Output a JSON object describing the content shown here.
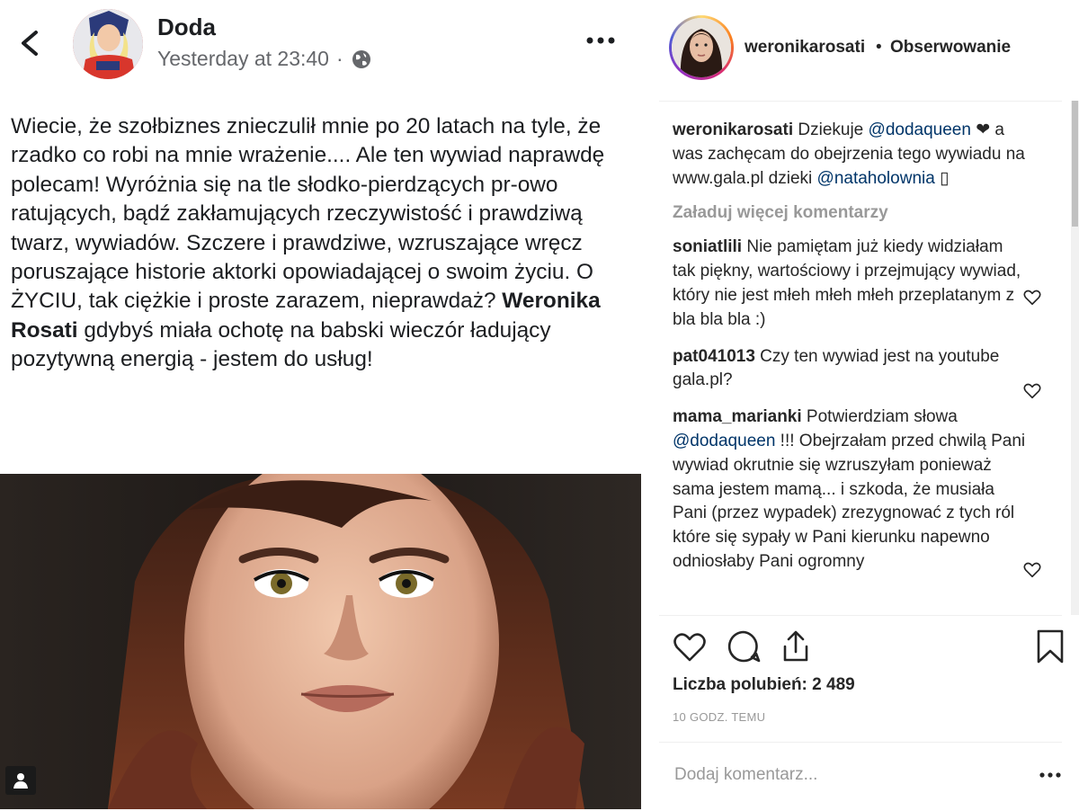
{
  "fb_post": {
    "author": "Doda",
    "timestamp": "Yesterday at 23:40",
    "separator": "·",
    "text_before": "Wiecie, że szołbiznes znieczulił mnie po 20 latach na tyle, że rzadko co robi na mnie wrażenie.... Ale ten wywiad naprawdę polecam! Wyróżnia się na tle słodko-pierdzących pr-owo ratujących, bądź zakłamujących rzeczywistość i prawdziwą twarz, wywiadów. Szczere i prawdziwe, wzruszające wręcz poruszające historie aktorki opowiadającej o swoim życiu. O ŻYCIU, tak ciężkie i proste zarazem, nieprawdaż? ",
    "tagged_name": "Weronika Rosati",
    "text_after": " gdybyś miała ochotę na babski wieczór ładujący pozytywną energią - jestem do usług!"
  },
  "instagram": {
    "username": "weronikarosati",
    "dot": "•",
    "follow_label": "Obserwowanie",
    "caption": {
      "user": "weronikarosati",
      "text1": " Dziekuje ",
      "mention1": "@dodaqueen",
      "text2": " ❤ a was zachęcam do obejrzenia tego wywiadu na www.gala.pl dzieki ",
      "mention2": "@nataholownia",
      "text3": " ▯"
    },
    "load_more": "Załaduj więcej komentarzy",
    "comments": [
      {
        "user": "soniatlili",
        "text": " Nie pamiętam już kiedy widziałam tak piękny, wartościowy i przejmujący wywiad, który nie jest młeh młeh młeh przeplatanym z bla bla bla :)"
      },
      {
        "user": "pat041013",
        "text": " Czy ten wywiad jest na youtube gala.pl?"
      },
      {
        "user": "mama_marianki",
        "text_a": " Potwierdziam słowa ",
        "mention": "@dodaqueen",
        "text_b": " !!! Obejrzałam przed chwilą Pani wywiad okrutnie się wzruszyłam ponieważ sama jestem mamą... i szkoda, że musiała Pani (przez wypadek) zrezygnować z tych ról które się sypały w Pani kierunku napewno odniosłaby Pani ogromny"
      }
    ],
    "likes": "Liczba polubień: 2 489",
    "time_ago": "10 GODZ. TEMU",
    "add_comment_placeholder": "Dodaj komentarz...",
    "icons": [
      "heart-icon",
      "comment-icon",
      "share-icon",
      "bookmark-icon",
      "more-icon"
    ],
    "colors": {
      "mention": "#003569",
      "muted": "#999999",
      "text": "#262626"
    }
  }
}
